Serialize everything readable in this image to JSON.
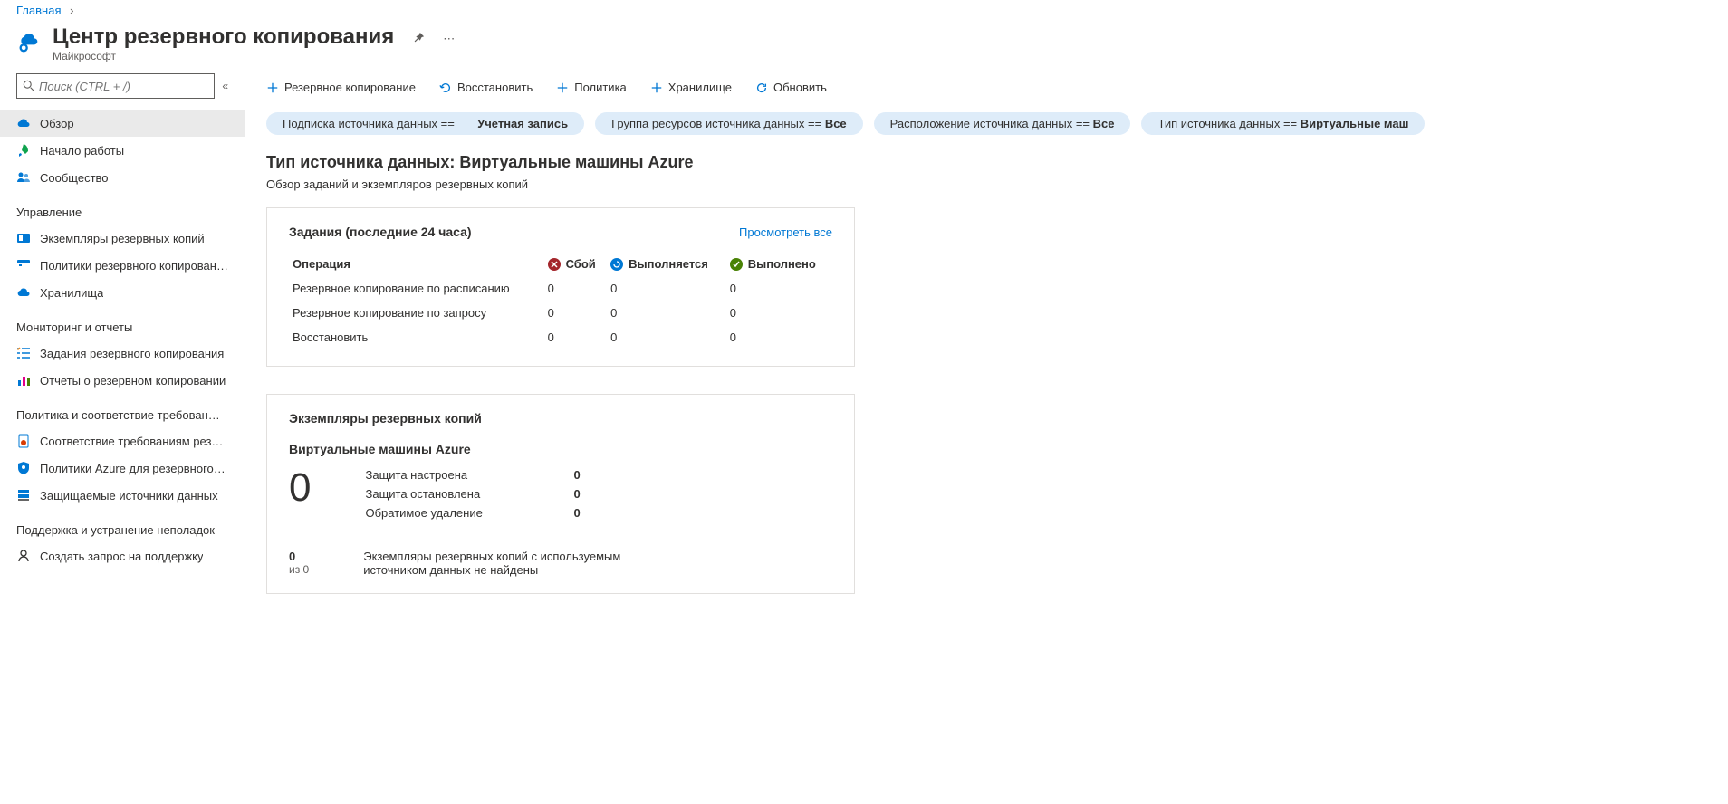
{
  "breadcrumb": {
    "home": "Главная"
  },
  "header": {
    "title": "Центр резервного копирования",
    "subtitle": "Майкрософт"
  },
  "search": {
    "placeholder": "Поиск (CTRL + /)"
  },
  "sidebar": {
    "top_items": [
      {
        "label": "Обзор"
      },
      {
        "label": "Начало работы"
      },
      {
        "label": "Сообщество"
      }
    ],
    "sections": [
      {
        "label": "Управление",
        "items": [
          {
            "label": "Экземпляры резервных копий"
          },
          {
            "label": "Политики резервного копирования"
          },
          {
            "label": "Хранилища"
          }
        ]
      },
      {
        "label": "Мониторинг и отчеты",
        "items": [
          {
            "label": "Задания резервного копирования"
          },
          {
            "label": "Отчеты о резервном копировании"
          }
        ]
      },
      {
        "label": "Политика и соответствие требован…",
        "items": [
          {
            "label": "Соответствие требованиям резер…"
          },
          {
            "label": "Политики Azure для резервного к…"
          },
          {
            "label": "Защищаемые источники данных"
          }
        ]
      },
      {
        "label": "Поддержка и устранение неполадок",
        "items": [
          {
            "label": "Создать запрос на поддержку"
          }
        ]
      }
    ]
  },
  "toolbar": {
    "backup": "Резервное копирование",
    "restore": "Восстановить",
    "policy": "Политика",
    "vault": "Хранилище",
    "refresh": "Обновить"
  },
  "filters": [
    {
      "prefix": "Подписка источника данных == ",
      "value": "Учетная запись"
    },
    {
      "prefix": "Группа ресурсов источника данных == ",
      "value": "Все"
    },
    {
      "prefix": "Расположение источника данных == ",
      "value": "Все"
    },
    {
      "prefix": "Тип источника данных == ",
      "value": "Виртуальные маш"
    }
  ],
  "main": {
    "title": "Тип источника данных: Виртуальные машины Azure",
    "subtitle": "Обзор заданий и экземпляров резервных копий"
  },
  "jobs_card": {
    "title": "Задания (последние 24 часа)",
    "view_all": "Просмотреть все",
    "col_op": "Операция",
    "col_fail": "Сбой",
    "col_prog": "Выполняется",
    "col_ok": "Выполнено",
    "rows": [
      {
        "op": "Резервное копирование по расписанию",
        "fail": "0",
        "prog": "0",
        "ok": "0"
      },
      {
        "op": "Резервное копирование по запросу",
        "fail": "0",
        "prog": "0",
        "ok": "0"
      },
      {
        "op": "Восстановить",
        "fail": "0",
        "prog": "0",
        "ok": "0"
      }
    ]
  },
  "instances_card": {
    "title": "Экземпляры резервных копий",
    "subtitle": "Виртуальные машины Azure",
    "big_number": "0",
    "kv": [
      {
        "k": "Защита настроена",
        "v": "0"
      },
      {
        "k": "Защита остановлена",
        "v": "0"
      },
      {
        "k": "Обратимое удаление",
        "v": "0"
      }
    ],
    "bottom_num": "0",
    "bottom_of": "из 0",
    "bottom_msg": "Экземпляры резервных копий с используемым источником данных не найдены"
  }
}
